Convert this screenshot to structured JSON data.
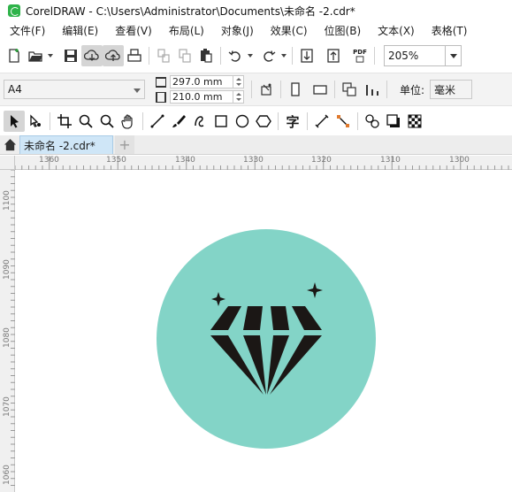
{
  "window": {
    "title": "CorelDRAW - C:\\Users\\Administrator\\Documents\\未命名 -2.cdr*"
  },
  "menu": [
    {
      "label": "文件(F)"
    },
    {
      "label": "编辑(E)"
    },
    {
      "label": "查看(V)"
    },
    {
      "label": "布局(L)"
    },
    {
      "label": "对象(J)"
    },
    {
      "label": "效果(C)"
    },
    {
      "label": "位图(B)"
    },
    {
      "label": "文本(X)"
    },
    {
      "label": "表格(T)"
    }
  ],
  "standard_toolbar": {
    "zoom": "205%",
    "pdf_icon_text": "PDF"
  },
  "property_bar": {
    "page_size": "A4",
    "width": "297.0 mm",
    "height": "210.0 mm",
    "unit_label": "单位:",
    "unit_value": "毫米"
  },
  "toolbox": {
    "text_tool_glyph": "字"
  },
  "tabs": [
    {
      "label": "未命名 -2.cdr*",
      "active": true
    }
  ],
  "rulers": {
    "horizontal": [
      "1360",
      "1350",
      "1340",
      "1330",
      "1320",
      "1310",
      "1300"
    ],
    "vertical": [
      "1100",
      "1090",
      "1080",
      "1070",
      "1060"
    ]
  },
  "artwork": {
    "circle_color": "#83d4c7",
    "diamond_color": "#1b1715"
  }
}
